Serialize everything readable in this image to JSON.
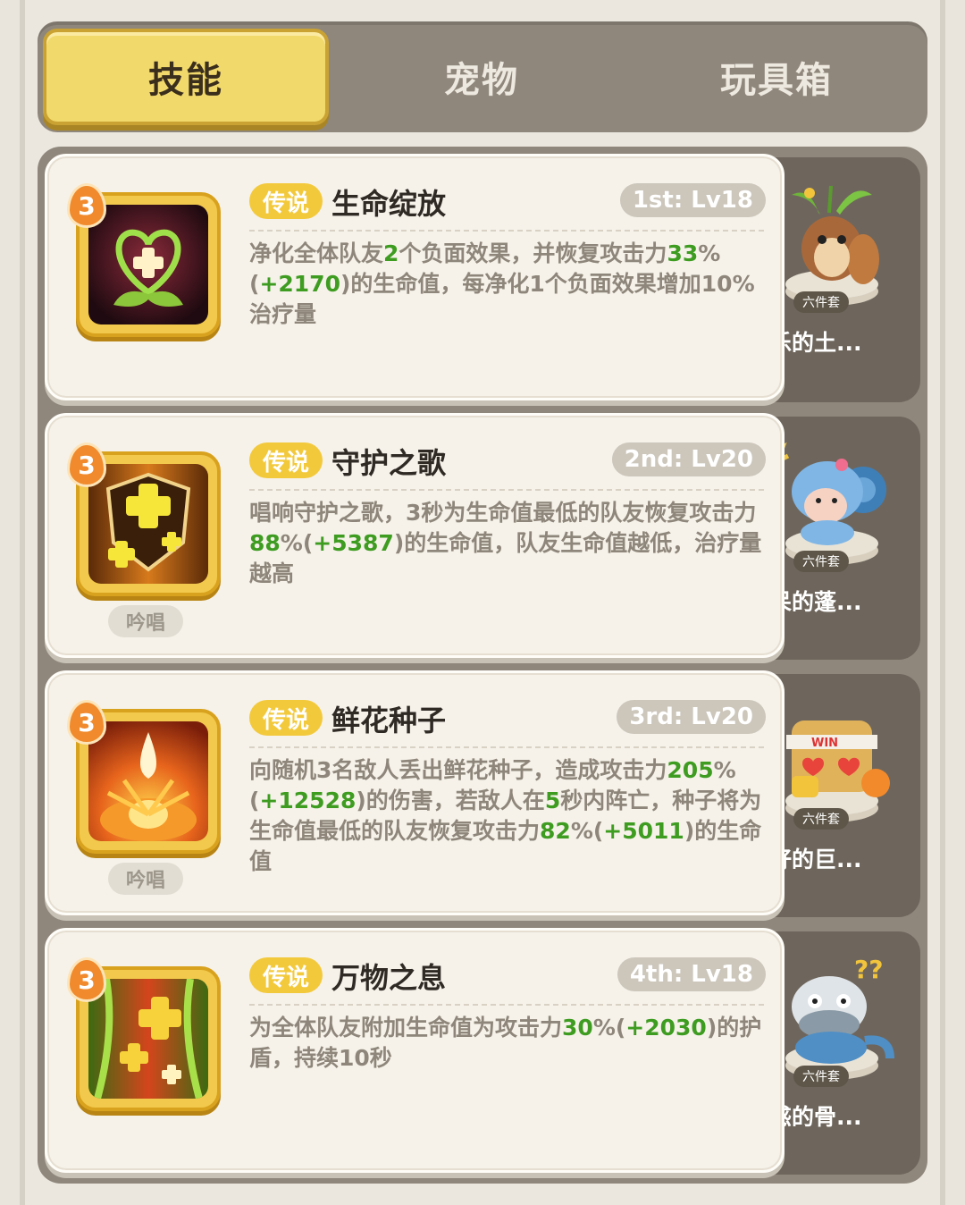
{
  "tabs": [
    "技能",
    "宠物",
    "玩具箱"
  ],
  "active_tab": 0,
  "rarity_label": "传说",
  "chant_label": "吟唱",
  "set_label": "六件套",
  "skills": [
    {
      "level": "3",
      "name": "生命绽放",
      "rank": "1st: Lv18",
      "desc": [
        {
          "t": "净化全体队友"
        },
        {
          "t": "2",
          "g": true
        },
        {
          "t": "个负面效果，并恢复攻击力"
        },
        {
          "t": "33",
          "g": true
        },
        {
          "t": "%("
        },
        {
          "t": "+2170",
          "g": true
        },
        {
          "t": ")的生命值，每净化1个负面效果增加10%治疗量"
        }
      ],
      "chant": false,
      "pet": "快乐的土..."
    },
    {
      "level": "3",
      "name": "守护之歌",
      "rank": "2nd: Lv20",
      "desc": [
        {
          "t": "唱响守护之歌，3秒为生命值最低的队友恢复攻击力"
        },
        {
          "t": "88",
          "g": true
        },
        {
          "t": "%("
        },
        {
          "t": "+5387",
          "g": true
        },
        {
          "t": ")的生命值，队友生命值越低，治疗量越高"
        }
      ],
      "chant": true,
      "pet": "发呆的蓬..."
    },
    {
      "level": "3",
      "name": "鲜花种子",
      "rank": "3rd: Lv20",
      "desc": [
        {
          "t": "向随机3名敌人丢出鲜花种子，造成攻击力"
        },
        {
          "t": "205",
          "g": true
        },
        {
          "t": "%("
        },
        {
          "t": "+12528",
          "g": true
        },
        {
          "t": ")的伤害，若敌人在"
        },
        {
          "t": "5",
          "g": true
        },
        {
          "t": "秒内阵亡，种子将为生命值最低的队友恢复攻击力"
        },
        {
          "t": "82",
          "g": true
        },
        {
          "t": "%("
        },
        {
          "t": "+5011",
          "g": true
        },
        {
          "t": ")的生命值"
        }
      ],
      "chant": true,
      "pet": "友好的巨..."
    },
    {
      "level": "3",
      "name": "万物之息",
      "rank": "4th: Lv18",
      "desc": [
        {
          "t": "为全体队友附加生命值为攻击力"
        },
        {
          "t": "30",
          "g": true
        },
        {
          "t": "%("
        },
        {
          "t": "+2030",
          "g": true
        },
        {
          "t": ")的护盾，持续10秒"
        }
      ],
      "chant": false,
      "pet": "困惑的骨..."
    }
  ],
  "icons": [
    "heart-plant-icon",
    "cross-shield-icon",
    "flower-seed-icon",
    "nature-breath-icon"
  ],
  "pet_icons": [
    "seedling-beaver-pet-icon",
    "blue-ram-pet-icon",
    "win-golem-pet-icon",
    "dragon-pet-icon"
  ]
}
